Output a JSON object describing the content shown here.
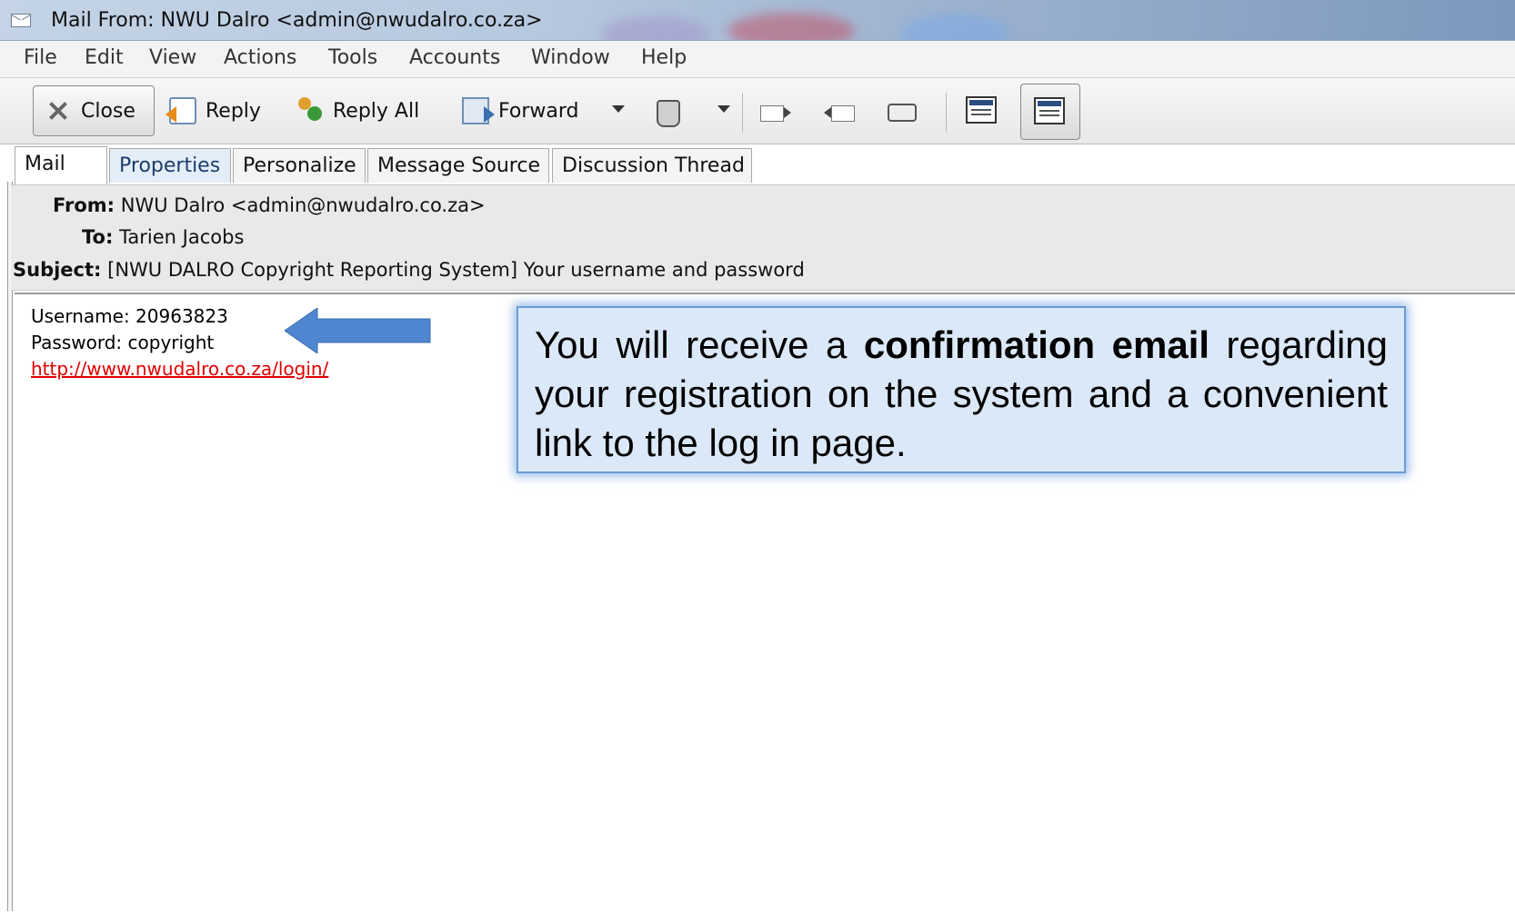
{
  "window": {
    "title": "Mail From: NWU Dalro <admin@nwudalro.co.za>"
  },
  "menu": [
    "File",
    "Edit",
    "View",
    "Actions",
    "Tools",
    "Accounts",
    "Window",
    "Help"
  ],
  "toolbar": {
    "close": "Close",
    "reply": "Reply",
    "reply_all": "Reply All",
    "forward": "Forward"
  },
  "tabs": [
    "Mail",
    "Properties",
    "Personalize",
    "Message Source",
    "Discussion Thread"
  ],
  "header": {
    "from_label": "From:",
    "from_value": "NWU Dalro <admin@nwudalro.co.za>",
    "to_label": "To:",
    "to_value": "Tarien Jacobs",
    "subject_label": "Subject:",
    "subject_value": "[NWU DALRO Copyright Reporting System] Your username and password"
  },
  "body": {
    "username_line": "Username: 20963823",
    "password_line": "Password: copyright",
    "link": "http://www.nwudalro.co.za/login/"
  },
  "callout": {
    "text_before": "You will receive a ",
    "text_bold": "confirmation email",
    "text_after": " regarding your registration on the system and a convenient link to the log in page."
  },
  "colors": {
    "link": "#e00000",
    "callout_fill": "#dbe8f8",
    "callout_border": "#6d9bd6",
    "arrow": "#4f86cf"
  }
}
